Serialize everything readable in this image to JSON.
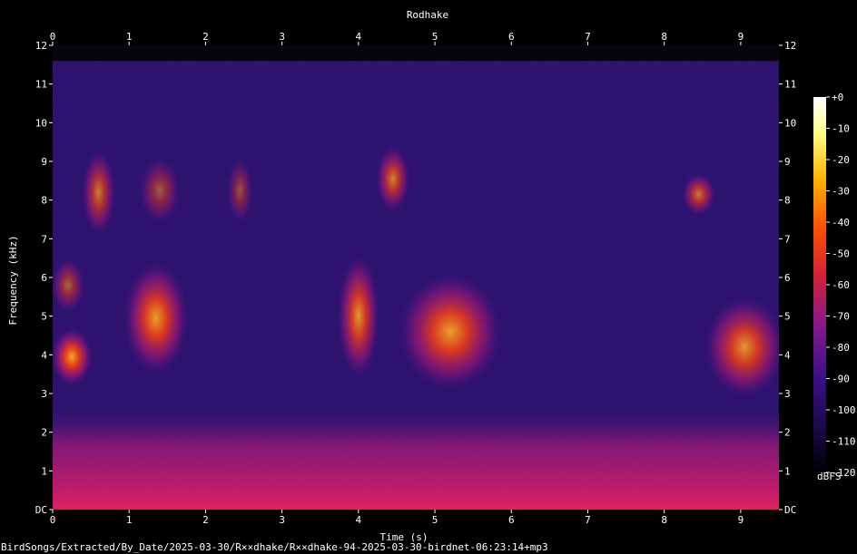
{
  "chart_data": {
    "type": "heatmap",
    "title": "Rodhake",
    "xlabel": "Time (s)",
    "ylabel": "Frequency (kHz)",
    "x_ticks": [
      "0",
      "1",
      "2",
      "3",
      "4",
      "5",
      "6",
      "7",
      "8",
      "9"
    ],
    "y_ticks": [
      "DC",
      "1",
      "2",
      "3",
      "4",
      "5",
      "6",
      "7",
      "8",
      "9",
      "10",
      "11",
      "12"
    ],
    "xlim": [
      0,
      9.5
    ],
    "ylim": [
      0,
      12
    ],
    "colorbar": {
      "ticks": [
        "+0",
        "-10",
        "-20",
        "-30",
        "-40",
        "-50",
        "-60",
        "-70",
        "-80",
        "-90",
        "-100",
        "-110",
        "-120"
      ],
      "unit_label": "dBFS",
      "range": [
        -120,
        0
      ],
      "colors": [
        "#000000",
        "#1a0a4a",
        "#3a0f8a",
        "#8a1a8a",
        "#d0203a",
        "#ff5000",
        "#ffb000",
        "#ffff80",
        "#ffffff"
      ]
    },
    "background_color": "#2a0f6a",
    "noise_floor_color": "#c8186a",
    "energy_blobs": [
      {
        "t0": 0.05,
        "t1": 0.45,
        "f0": 3.3,
        "f1": 4.6,
        "level": 0.95
      },
      {
        "t0": 0.05,
        "t1": 0.35,
        "f0": 5.2,
        "f1": 6.4,
        "level": 0.55
      },
      {
        "t0": 0.45,
        "t1": 0.75,
        "f0": 7.2,
        "f1": 9.2,
        "level": 0.7
      },
      {
        "t0": 1.0,
        "t1": 1.7,
        "f0": 3.6,
        "f1": 6.3,
        "level": 0.9
      },
      {
        "t0": 1.2,
        "t1": 1.6,
        "f0": 7.5,
        "f1": 9.0,
        "level": 0.5
      },
      {
        "t0": 2.35,
        "t1": 2.55,
        "f0": 7.5,
        "f1": 9.0,
        "level": 0.45
      },
      {
        "t0": 3.8,
        "t1": 4.2,
        "f0": 3.5,
        "f1": 6.5,
        "level": 0.85
      },
      {
        "t0": 4.3,
        "t1": 4.6,
        "f0": 7.8,
        "f1": 9.3,
        "level": 0.75
      },
      {
        "t0": 4.6,
        "t1": 5.8,
        "f0": 3.2,
        "f1": 6.0,
        "level": 0.9
      },
      {
        "t0": 8.3,
        "t1": 8.6,
        "f0": 7.7,
        "f1": 8.6,
        "level": 0.7
      },
      {
        "t0": 8.6,
        "t1": 9.5,
        "f0": 3.0,
        "f1": 5.4,
        "level": 0.85
      }
    ]
  },
  "footer": {
    "filename": "BirdSongs/Extracted/By_Date/2025-03-30/R××dhake/R××dhake-94-2025-03-30-birdnet-06:23:14+mp3"
  }
}
